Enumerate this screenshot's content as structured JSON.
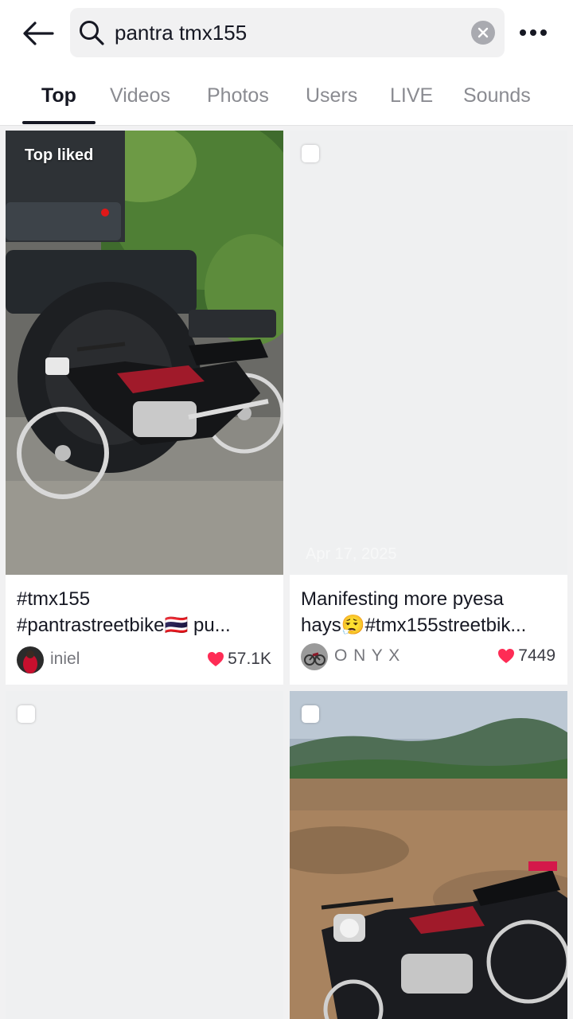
{
  "search": {
    "query": "pantra tmx155"
  },
  "tabs": [
    {
      "label": "Top",
      "active": true
    },
    {
      "label": "Videos",
      "active": false
    },
    {
      "label": "Photos",
      "active": false
    },
    {
      "label": "Users",
      "active": false
    },
    {
      "label": "LIVE",
      "active": false
    },
    {
      "label": "Sounds",
      "active": false
    }
  ],
  "results": [
    {
      "badge": "Top liked",
      "caption_line1": "#tmx155",
      "caption_line2": "#pantrastreetbike🇹🇭 pu...",
      "author": "iniel",
      "likes": "57.1K"
    },
    {
      "date": "Apr 17, 2025",
      "caption_line1": "Manifesting more pyesa",
      "caption_line2": "hays😮‍💨#tmx155streetbik...",
      "author": "O N Y X",
      "likes": "7449"
    },
    {},
    {}
  ],
  "colors": {
    "accent_like": "#fe2c55",
    "text_primary": "#161823",
    "text_muted": "#8a8b91"
  },
  "icons": [
    "back-arrow-icon",
    "search-icon",
    "clear-icon",
    "more-icon",
    "heart-icon"
  ]
}
